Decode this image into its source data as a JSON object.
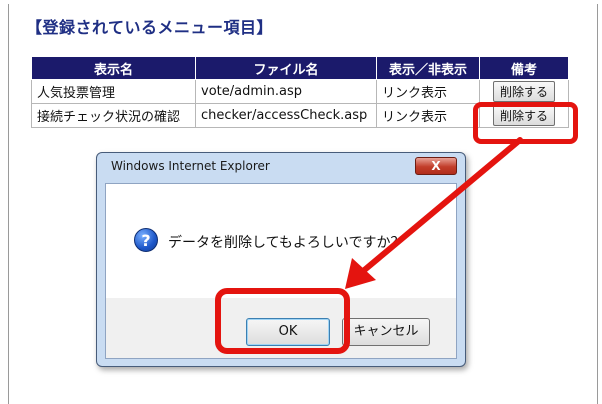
{
  "section_title": "【登録されているメニュー項目】",
  "table": {
    "headers": [
      "表示名",
      "ファイル名",
      "表示／非表示",
      "備考"
    ],
    "rows": [
      {
        "display_name": "人気投票管理",
        "file_name": "vote/admin.asp",
        "visibility": "リンク表示",
        "action": "削除する"
      },
      {
        "display_name": "接続チェック状況の確認",
        "file_name": "checker/accessCheck.asp",
        "visibility": "リンク表示",
        "action": "削除する"
      }
    ]
  },
  "dialog": {
    "title": "Windows Internet Explorer",
    "close_label": "X",
    "icon": "question-icon",
    "message": "データを削除してもよろしいですか？",
    "ok_label": "OK",
    "cancel_label": "キャンセル"
  },
  "colors": {
    "title": "#1f2f84",
    "header_bg": "#1b1a6b",
    "highlight": "#e4140f"
  }
}
